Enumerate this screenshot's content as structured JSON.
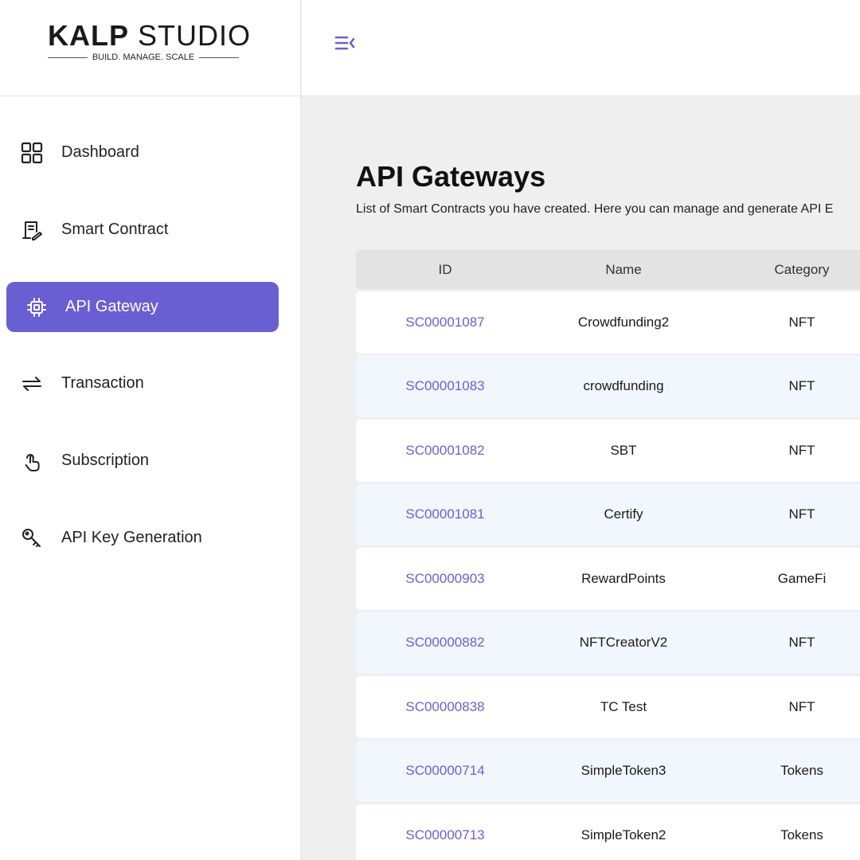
{
  "brand": {
    "name_bold": "KALP",
    "name_light": "STUDIO",
    "tagline": "BUILD. MANAGE. SCALE",
    "accent": "#6a5fd2"
  },
  "sidebar": {
    "items": [
      {
        "label": "Dashboard",
        "icon": "grid-icon",
        "active": false
      },
      {
        "label": "Smart Contract",
        "icon": "contract-icon",
        "active": false
      },
      {
        "label": "API Gateway",
        "icon": "chip-icon",
        "active": true
      },
      {
        "label": "Transaction",
        "icon": "swap-arrows-icon",
        "active": false
      },
      {
        "label": "Subscription",
        "icon": "tap-hand-icon",
        "active": false
      },
      {
        "label": "API Key Generation",
        "icon": "key-icon",
        "active": false
      }
    ]
  },
  "header": {
    "menu_icon": "menu-collapse-icon"
  },
  "main": {
    "title": "API Gateways",
    "subtitle": "List of Smart Contracts you have created. Here you can manage and generate API E",
    "columns": [
      "ID",
      "Name",
      "Category"
    ],
    "rows": [
      {
        "id": "SC00001087",
        "name": "Crowdfunding2",
        "category": "NFT"
      },
      {
        "id": "SC00001083",
        "name": "crowdfunding",
        "category": "NFT"
      },
      {
        "id": "SC00001082",
        "name": "SBT",
        "category": "NFT"
      },
      {
        "id": "SC00001081",
        "name": "Certify",
        "category": "NFT"
      },
      {
        "id": "SC00000903",
        "name": "RewardPoints",
        "category": "GameFi"
      },
      {
        "id": "SC00000882",
        "name": "NFTCreatorV2",
        "category": "NFT"
      },
      {
        "id": "SC00000838",
        "name": "TC Test",
        "category": "NFT"
      },
      {
        "id": "SC00000714",
        "name": "SimpleToken3",
        "category": "Tokens"
      },
      {
        "id": "SC00000713",
        "name": "SimpleToken2",
        "category": "Tokens"
      }
    ]
  }
}
